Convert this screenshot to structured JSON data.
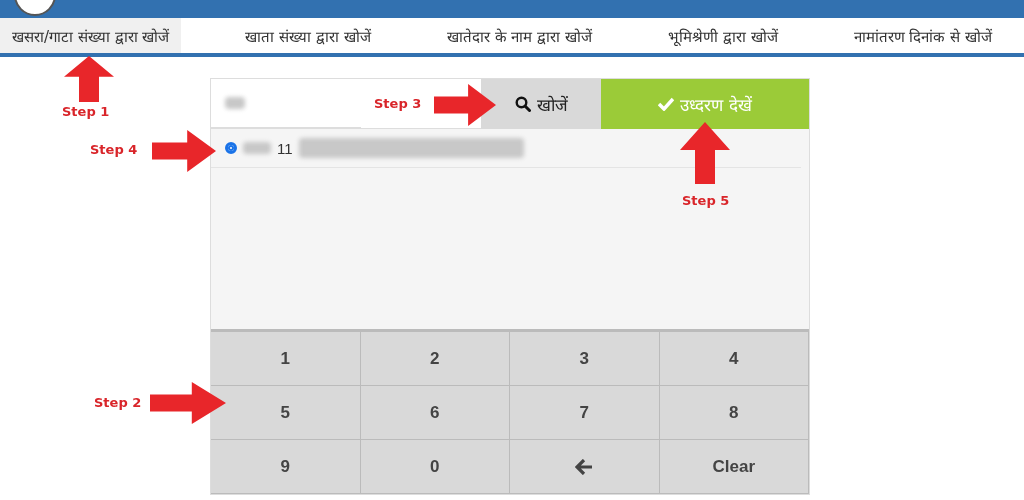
{
  "tabs": [
    {
      "label": "खसरा/गाटा संख्या द्वारा खोजें",
      "selected": true
    },
    {
      "label": "खाता संख्या द्वारा खोजें",
      "selected": false
    },
    {
      "label": "खातेदार के नाम द्वारा खोजें",
      "selected": false
    },
    {
      "label": "भूमिश्रेणी द्वारा खोजें",
      "selected": false
    },
    {
      "label": "नामांतरण दिनांक से खोजें",
      "selected": false
    }
  ],
  "search_button": "खोजें",
  "view_button": "उध्दरण देखें",
  "results": [
    {
      "text": "11",
      "selected": true
    }
  ],
  "keypad": [
    {
      "kind": "key",
      "label": "1"
    },
    {
      "kind": "key",
      "label": "2"
    },
    {
      "kind": "key",
      "label": "3"
    },
    {
      "kind": "key",
      "label": "4"
    },
    {
      "kind": "key",
      "label": "5"
    },
    {
      "kind": "key",
      "label": "6"
    },
    {
      "kind": "key",
      "label": "7"
    },
    {
      "kind": "key",
      "label": "8"
    },
    {
      "kind": "key",
      "label": "9"
    },
    {
      "kind": "key",
      "label": "0"
    },
    {
      "kind": "backspace"
    },
    {
      "kind": "key",
      "label": "Clear"
    }
  ],
  "annotations": [
    {
      "label": "Step 1",
      "kind": "up"
    },
    {
      "label": "Step 4",
      "kind": "right"
    },
    {
      "label": "Step 3",
      "kind": "right"
    },
    {
      "label": "Step 5",
      "kind": "up"
    },
    {
      "label": "Step 2",
      "kind": "right"
    }
  ]
}
